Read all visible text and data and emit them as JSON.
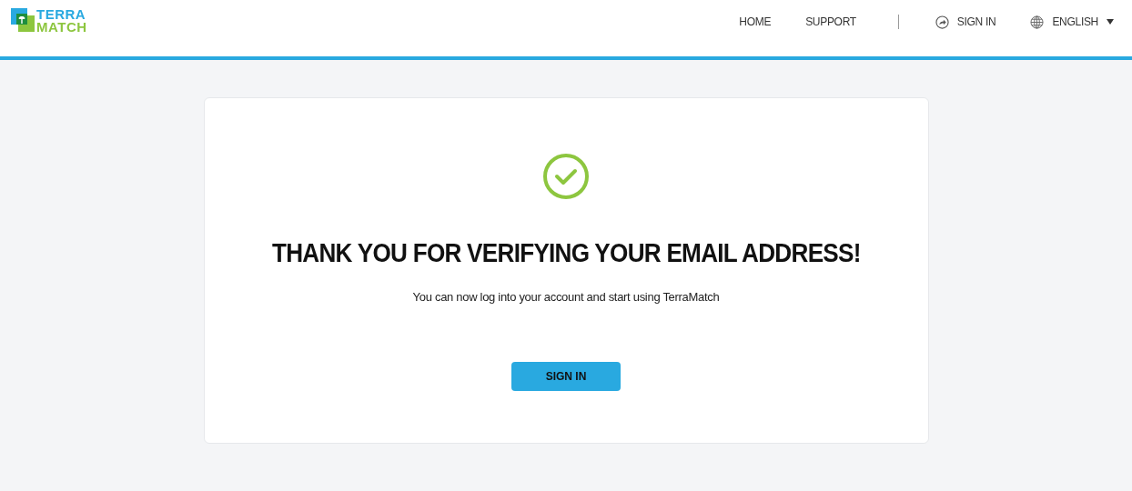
{
  "logo": {
    "line_1": "TERRA",
    "line_2": "MATCH"
  },
  "nav": [
    {
      "label": "HOME",
      "kind": "link"
    },
    {
      "label": "SUPPORT",
      "kind": "link"
    },
    {
      "label": "SIGN IN",
      "kind": "signin"
    },
    {
      "label": "ENGLISH",
      "kind": "language"
    }
  ],
  "card": {
    "title": "THANK YOU FOR VERIFYING YOUR EMAIL ADDRESS!",
    "message": "You can now log into your account and start using TerraMatch",
    "button": "SIGN IN"
  }
}
